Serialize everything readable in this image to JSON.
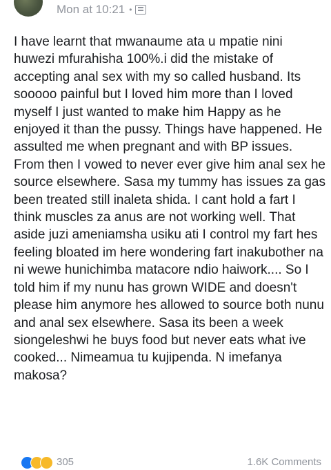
{
  "post": {
    "timestamp": "Mon at 10:21",
    "separator": "•",
    "privacy_icon": "globe-icon",
    "text": "I have learnt that mwanaume ata u mpatie nini huwezi mfurahisha 100%.i did the mistake of accepting anal sex with my so called husband. Its sooooo painful but I loved him more than I loved myself I just wanted to make him Happy as he enjoyed it than the pussy. Things have happened. He assulted me when pregnant and with BP issues. From then I vowed to never ever give him anal sex he source elsewhere. Sasa my tummy has issues za gas been treated still inaleta shida. I cant hold a fart I think muscles za anus are not working well. That aside juzi ameniamsha usiku ati I control my fart hes feeling bloated im here wondering fart inakubother na ni wewe hunichimba matacore ndio haiwork.... So I told him if my nunu has grown WIDE and doesn't please him anymore hes allowed to source both nunu and anal sex elsewhere. Sasa its been a week siongeleshwi he buys food but never eats what ive cooked... Nimeamua tu kujipenda. N imefanya makosa?"
  },
  "footer": {
    "reaction_icons": [
      "like-icon",
      "haha-icon",
      "wow-icon"
    ],
    "reaction_count": "305",
    "comments_label": "1.6K Comments"
  },
  "colors": {
    "meta_gray": "#90949c",
    "text": "#1c1e21",
    "like_blue": "#1877f2",
    "emoji_yellow": "#f7b928"
  }
}
